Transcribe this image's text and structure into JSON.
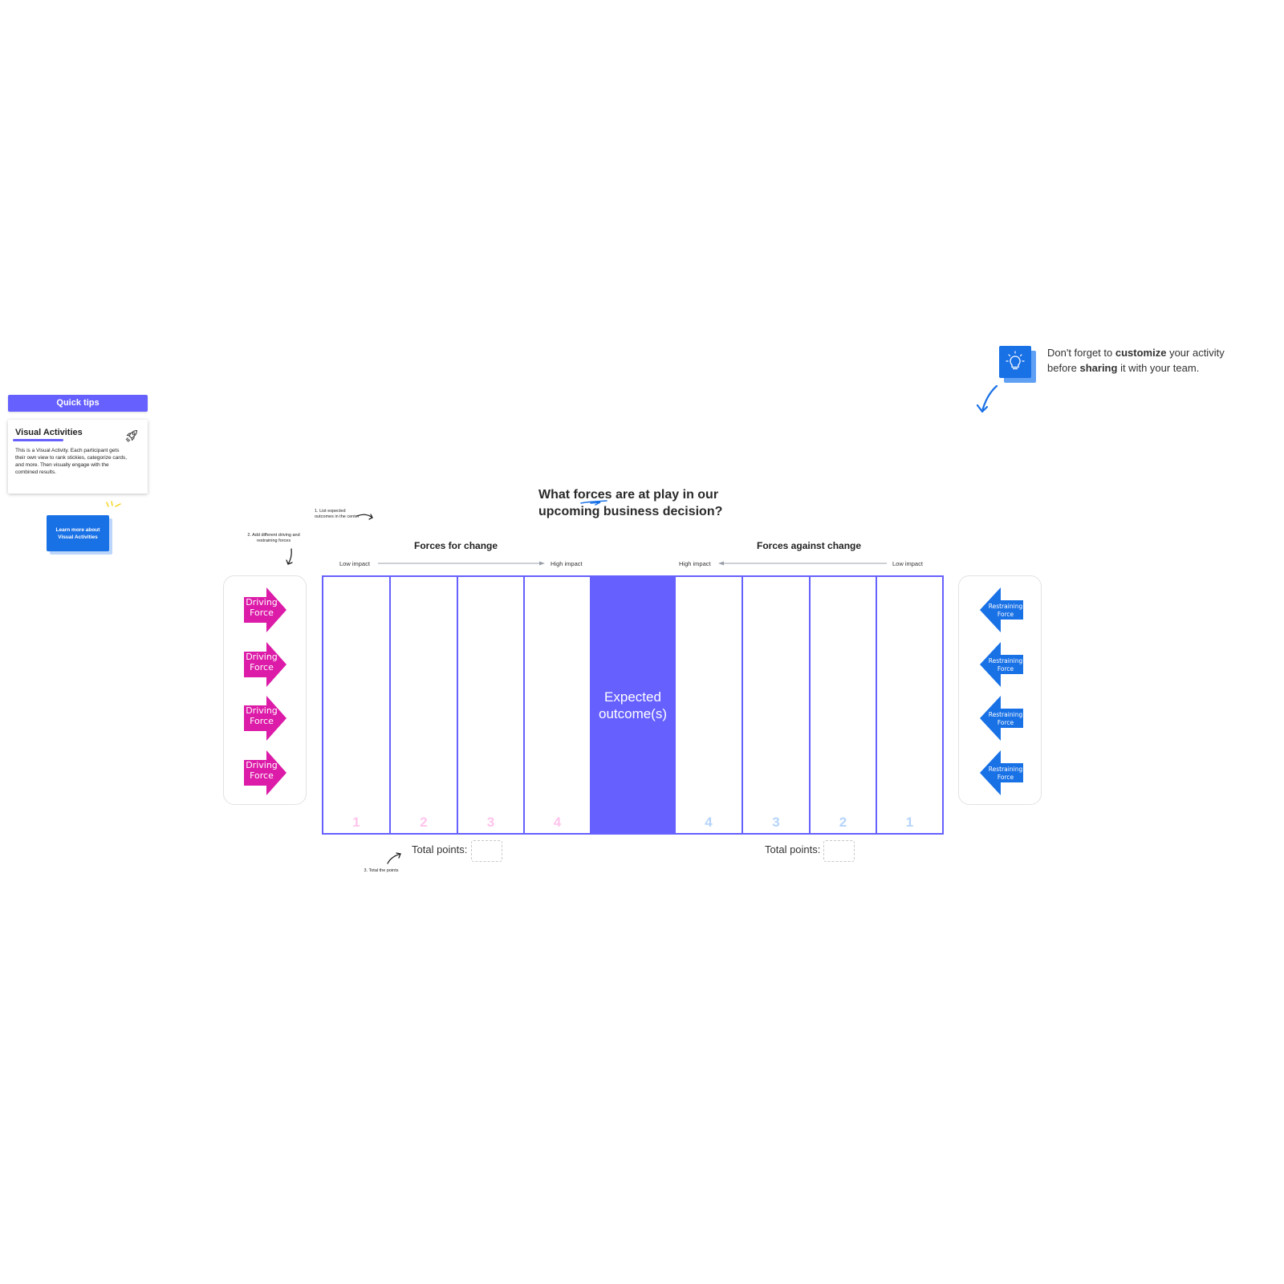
{
  "quick_tips": {
    "header": "Quick tips",
    "card_title": "Visual Activities",
    "card_body": "This is a Visual Activity. Each participant gets their own view to rank stickies, categorize cards, and more. Then visually engage with the combined results.",
    "card_icon": "rocket-icon",
    "learn_more_label": "Learn more about Visual Activities"
  },
  "tip": {
    "icon": "lightbulb-icon",
    "text_parts": [
      "Don't forget to ",
      "customize",
      " your activity before ",
      "sharing",
      " it with your team."
    ]
  },
  "title": "What forces are at play in our upcoming business decision?",
  "instructions": {
    "step1": "1. List expected outcomes in the center",
    "step2": "2. Add different driving and restraining forces",
    "step3": "3. Total the points"
  },
  "sections": {
    "for_title": "Forces for change",
    "against_title": "Forces against change",
    "for_scale": {
      "start": "Low impact",
      "end": "High impact"
    },
    "against_scale": {
      "start": "High impact",
      "end": "Low impact"
    }
  },
  "driving_forces": [
    "Driving Force",
    "Driving Force",
    "Driving Force",
    "Driving Force"
  ],
  "restraining_forces": [
    "Restraining Force",
    "Restraining Force",
    "Restraining Force",
    "Restraining Force"
  ],
  "grid": {
    "for_columns": [
      "1",
      "2",
      "3",
      "4"
    ],
    "center_label": "Expected outcome(s)",
    "against_columns": [
      "4",
      "3",
      "2",
      "1"
    ]
  },
  "totals": {
    "left_label": "Total points:",
    "left_value": "",
    "right_label": "Total points:",
    "right_value": ""
  },
  "colors": {
    "accent": "#6660ff",
    "driving": "#dc1ba8",
    "restraining": "#1971e6",
    "for_numbers": "#ffc4ec",
    "against_numbers": "#b5d4fb"
  }
}
